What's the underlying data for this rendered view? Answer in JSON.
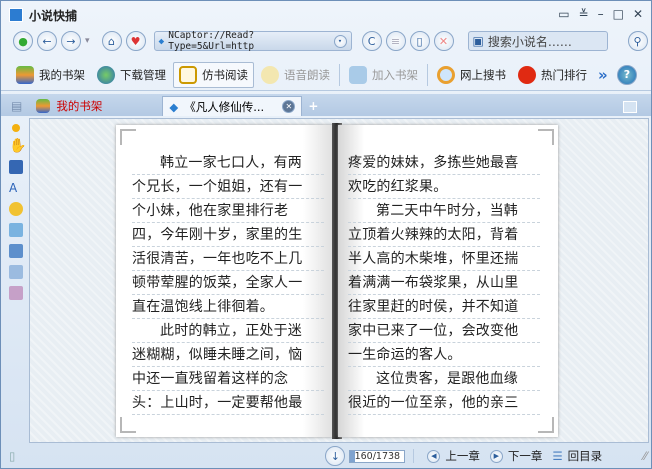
{
  "app": {
    "title": "小说快捕"
  },
  "nav": {
    "address": "NCaptor://Read?Type=5&Url=http",
    "search_placeholder": "搜索小说名……"
  },
  "toolbar": {
    "items": [
      "我的书架",
      "下载管理",
      "仿书阅读",
      "语音朗读",
      "加入书架",
      "网上搜书",
      "热门排行"
    ],
    "more": "»",
    "help": "?"
  },
  "tabs": [
    {
      "label": "我的书架",
      "color": "#cc0000"
    },
    {
      "label": "《凡人修仙传..."
    }
  ],
  "book": {
    "left": [
      {
        "t": "韩立一家七口人，有两",
        "i": 1
      },
      {
        "t": "个兄长，一个姐姐，还有一"
      },
      {
        "t": "个小妹，他在家里排行老"
      },
      {
        "t": "四，今年刚十岁，家里的生"
      },
      {
        "t": "活很清苦，一年也吃不上几"
      },
      {
        "t": "顿带荤腥的饭菜，全家人一"
      },
      {
        "t": "直在温饱线上徘徊着。"
      },
      {
        "t": "此时的韩立，正处于迷",
        "i": 1
      },
      {
        "t": "迷糊糊，似睡未睡之间，恼"
      },
      {
        "t": "中还一直残留着这样的念"
      },
      {
        "t": "头：上山时，一定要帮他最"
      }
    ],
    "right": [
      {
        "t": "疼爱的妹妹，多拣些她最喜"
      },
      {
        "t": "欢吃的红浆果。"
      },
      {
        "t": "第二天中午时分，当韩",
        "i": 1
      },
      {
        "t": "立顶着火辣辣的太阳，背着"
      },
      {
        "t": "半人高的木柴堆，怀里还揣"
      },
      {
        "t": "着满满一布袋浆果，从山里"
      },
      {
        "t": "往家里赶的时侯，并不知道"
      },
      {
        "t": "家中已来了一位，会改变他"
      },
      {
        "t": "一生命运的客人。"
      },
      {
        "t": "这位贵客，是跟他血缘",
        "i": 1
      },
      {
        "t": "很近的一位至亲，他的亲三"
      }
    ]
  },
  "status": {
    "page": "160/1738",
    "progress": 0.092,
    "prev": "上一章",
    "next": "下一章",
    "toc": "回目录"
  }
}
